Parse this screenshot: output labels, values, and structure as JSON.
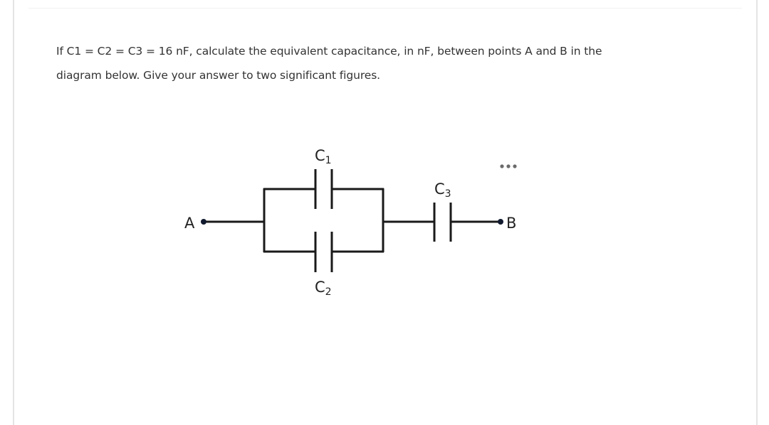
{
  "question": {
    "line1": "If C1  =  C2  =  C3  =  16 nF, calculate the equivalent capacitance, in nF, between points A and B in the",
    "line2": "diagram below. Give your answer to two significant figures."
  },
  "diagram": {
    "node_a_label": "A",
    "node_b_label": "B",
    "c1_label": "C",
    "c1_sub": "1",
    "c2_label": "C",
    "c2_sub": "2",
    "c3_label": "C",
    "c3_sub": "3",
    "more_icon": "ellipsis-icon"
  }
}
